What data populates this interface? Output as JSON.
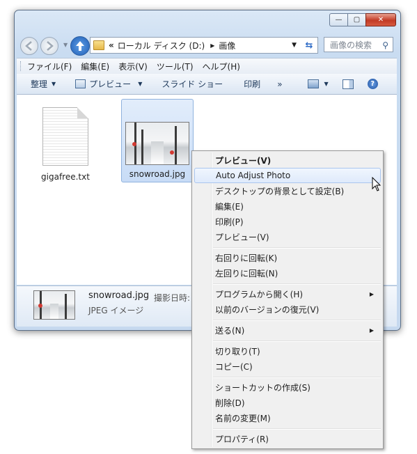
{
  "window": {
    "caption_buttons": [
      "minimize",
      "maximize",
      "close"
    ]
  },
  "navigation": {
    "back_icon": "back-arrow-icon",
    "forward_icon": "forward-arrow-icon",
    "up_icon": "up-arrow-icon",
    "address_overflow": "«",
    "address_crumb_drive": "ローカル ディスク (D:)",
    "address_crumb_folder": "画像",
    "refresh_icon": "refresh-icon",
    "search_placeholder": "画像の検索"
  },
  "menubar": {
    "items": [
      "ファイル(F)",
      "編集(E)",
      "表示(V)",
      "ツール(T)",
      "ヘルプ(H)"
    ]
  },
  "toolbar": {
    "organize": "整理",
    "preview": "プレビュー",
    "slideshow": "スライド ショー",
    "print": "印刷",
    "overflow": "»"
  },
  "files": [
    {
      "name": "gigafree.txt",
      "icon": "text-document-icon",
      "selected": false
    },
    {
      "name": "snowroad.jpg",
      "icon": "jpeg-thumbnail",
      "selected": true
    }
  ],
  "details_pane": {
    "filename": "snowroad.jpg",
    "date_label": "撮影日時:",
    "type": "JPEG イメージ"
  },
  "context_menu": {
    "items": [
      {
        "label": "プレビュー(V)",
        "bold": true
      },
      {
        "label": "Auto Adjust Photo",
        "highlighted": true
      },
      {
        "label": "デスクトップの背景として設定(B)"
      },
      {
        "label": "編集(E)"
      },
      {
        "label": "印刷(P)"
      },
      {
        "label": "プレビュー(V)"
      },
      {
        "label": "右回りに回転(K)"
      },
      {
        "label": "左回りに回転(N)"
      },
      {
        "label": "プログラムから開く(H)",
        "submenu": true
      },
      {
        "label": "以前のバージョンの復元(V)"
      },
      {
        "label": "送る(N)",
        "submenu": true
      },
      {
        "label": "切り取り(T)"
      },
      {
        "label": "コピー(C)"
      },
      {
        "label": "ショートカットの作成(S)"
      },
      {
        "label": "削除(D)"
      },
      {
        "label": "名前の変更(M)"
      },
      {
        "label": "プロパティ(R)"
      }
    ]
  }
}
